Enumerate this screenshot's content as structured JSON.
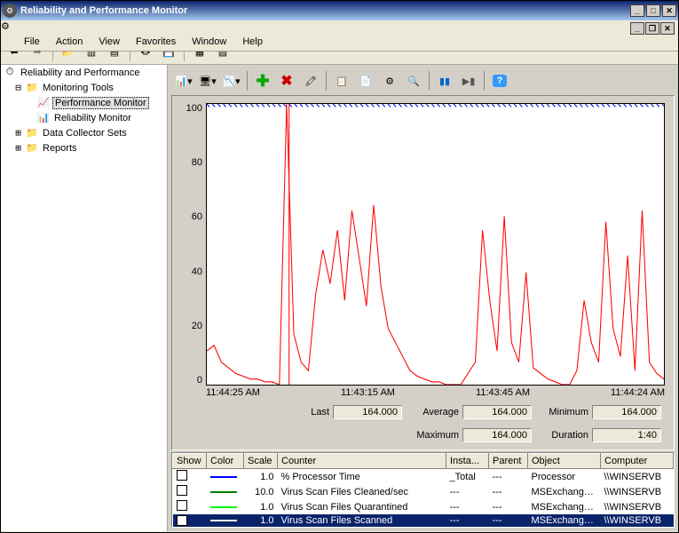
{
  "window": {
    "title": "Reliability and Performance Monitor"
  },
  "menu": [
    "File",
    "Action",
    "View",
    "Favorites",
    "Window",
    "Help"
  ],
  "tree": {
    "root": "Reliability and Performance",
    "monitoring": "Monitoring Tools",
    "perf": "Performance Monitor",
    "rel": "Reliability Monitor",
    "dcs": "Data Collector Sets",
    "reports": "Reports"
  },
  "chart_data": {
    "type": "line",
    "title": "",
    "xlabel": "",
    "ylabel": "",
    "ylim": [
      0,
      100
    ],
    "y_ticks": [
      100,
      80,
      60,
      40,
      20,
      0
    ],
    "x_ticks": [
      "11:44:25 AM",
      "11:43:15 AM",
      "11:43:45 AM",
      "11:44:24 AM"
    ],
    "series": [
      {
        "name": "Virus Scan Files Scanned",
        "color": "#ff0000",
        "values": [
          12,
          14,
          8,
          6,
          4,
          3,
          2,
          2,
          1,
          1,
          0,
          100,
          18,
          8,
          5,
          32,
          48,
          36,
          55,
          30,
          62,
          45,
          28,
          64,
          35,
          20,
          15,
          10,
          5,
          3,
          2,
          1,
          1,
          0,
          0,
          0,
          4,
          8,
          55,
          30,
          12,
          60,
          15,
          8,
          40,
          6,
          4,
          2,
          1,
          0,
          0,
          5,
          30,
          15,
          8,
          58,
          20,
          10,
          46,
          5,
          62,
          8,
          4,
          2
        ]
      }
    ]
  },
  "stats": {
    "last_label": "Last",
    "last": "164.000",
    "avg_label": "Average",
    "avg": "164.000",
    "min_label": "Minimum",
    "min": "164.000",
    "max_label": "Maximum",
    "max": "164.000",
    "dur_label": "Duration",
    "dur": "1:40"
  },
  "counters": {
    "headers": [
      "Show",
      "Color",
      "Scale",
      "Counter",
      "Insta...",
      "Parent",
      "Object",
      "Computer"
    ],
    "rows": [
      {
        "show": false,
        "color": "#0000ff",
        "scale": "1.0",
        "counter": "% Processor Time",
        "inst": "_Total",
        "parent": "---",
        "object": "Processor",
        "computer": "\\\\WINSERVB"
      },
      {
        "show": false,
        "color": "#008000",
        "scale": "10.0",
        "counter": "Virus Scan Files Cleaned/sec",
        "inst": "---",
        "parent": "---",
        "object": "MSExchangeIS",
        "computer": "\\\\WINSERVB"
      },
      {
        "show": false,
        "color": "#00ff00",
        "scale": "1.0",
        "counter": "Virus Scan Files Quarantined",
        "inst": "---",
        "parent": "---",
        "object": "MSExchangeIS",
        "computer": "\\\\WINSERVB"
      },
      {
        "show": true,
        "color": "#ffffff",
        "scale": "1.0",
        "counter": "Virus Scan Files Scanned",
        "inst": "---",
        "parent": "---",
        "object": "MSExchangeIS",
        "computer": "\\\\WINSERVB",
        "selected": true
      }
    ]
  }
}
